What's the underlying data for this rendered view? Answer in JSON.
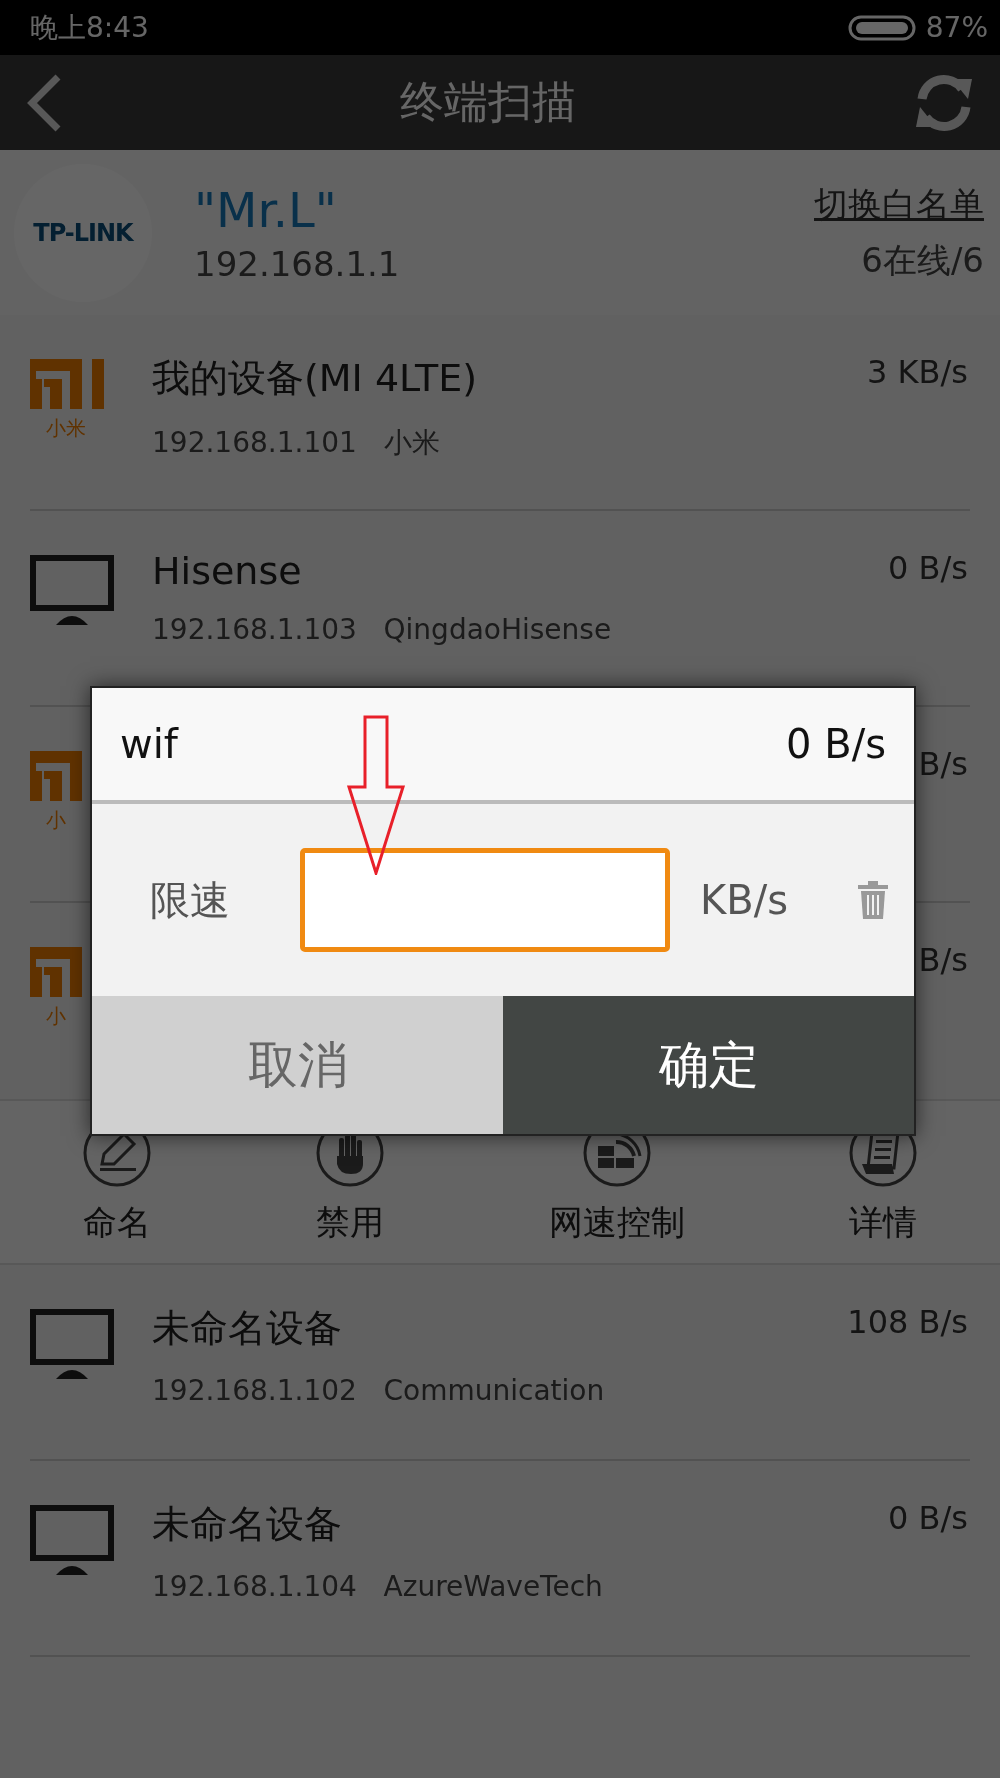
{
  "status_bar": {
    "time": "晚上8:43",
    "battery": "87%"
  },
  "header": {
    "title": "终端扫描"
  },
  "router": {
    "logo": "TP-LINK",
    "name": "\"Mr.L\"",
    "ip": "192.168.1.1",
    "whitelist_link": "切换白名单",
    "online": "6在线/6"
  },
  "devices": [
    {
      "kind": "mi",
      "brand": "小米",
      "name": "我的设备(MI 4LTE)",
      "ip": "192.168.1.101",
      "vendor": "小米",
      "speed": "3 KB/s",
      "expanded": false
    },
    {
      "kind": "tv",
      "name": "Hisense",
      "ip": "192.168.1.103",
      "vendor": "QingdaoHisense",
      "speed": "0 B/s",
      "expanded": false
    },
    {
      "kind": "mi",
      "brand": "小",
      "speed": "B/s",
      "expanded": false
    },
    {
      "kind": "mi",
      "brand": "小",
      "speed": "B/s",
      "expanded": true,
      "actions": [
        {
          "kind": "rename",
          "label": "命名"
        },
        {
          "kind": "block",
          "label": "禁用"
        },
        {
          "kind": "speed",
          "label": "网速控制"
        },
        {
          "kind": "details",
          "label": "详情"
        }
      ]
    },
    {
      "kind": "tv",
      "name": "未命名设备",
      "ip": "192.168.1.102",
      "vendor": "Communication",
      "speed": "108 B/s",
      "expanded": false
    },
    {
      "kind": "tv",
      "name": "未命名设备",
      "ip": "192.168.1.104",
      "vendor": "AzureWaveTech",
      "speed": "0 B/s",
      "expanded": false
    }
  ],
  "dialog": {
    "device": "wif",
    "speed": "0 B/s",
    "label": "限速",
    "unit": "KB/s",
    "cancel": "取消",
    "confirm": "确定"
  }
}
